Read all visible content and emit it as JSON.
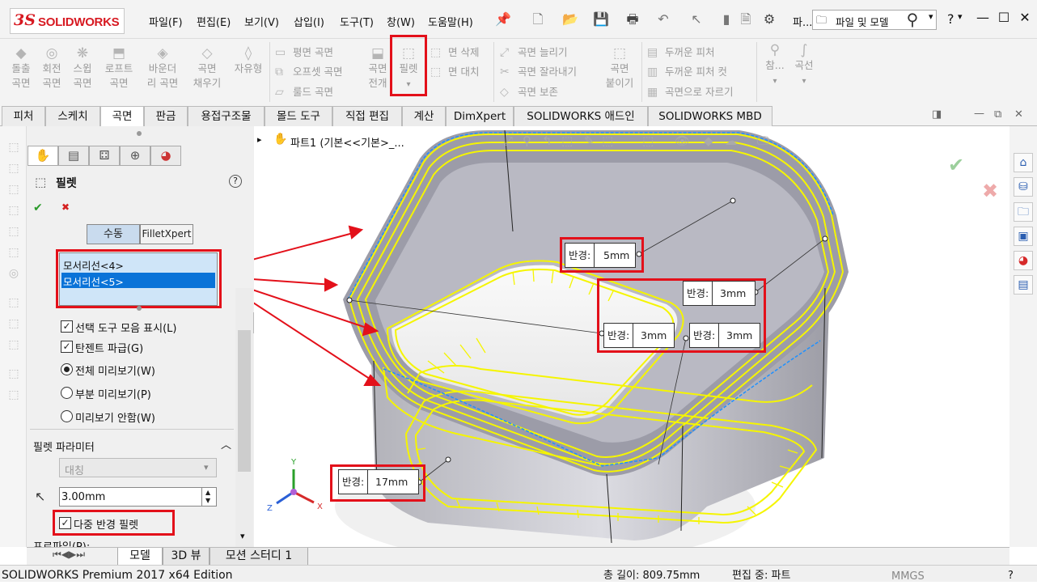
{
  "app": {
    "logo_ds": "3S",
    "logo_text": "SOLIDWORKS"
  },
  "menu": [
    "파일(F)",
    "편집(E)",
    "보기(V)",
    "삽입(I)",
    "도구(T)",
    "창(W)",
    "도움말(H)"
  ],
  "quick": {
    "pin_icon": "pin-icon",
    "label_fa": "파..."
  },
  "search": {
    "label": "파일 및 모델",
    "question": "?"
  },
  "ribbon": {
    "big": [
      {
        "l1": "돌출",
        "l2": "곡면"
      },
      {
        "l1": "회전",
        "l2": "곡면"
      },
      {
        "l1": "스윕",
        "l2": "곡면"
      },
      {
        "l1": "로프트",
        "l2": "곡면"
      },
      {
        "l1": "바운더",
        "l2": "리 곡면"
      },
      {
        "l1": "곡면",
        "l2": "채우기"
      },
      {
        "l1": "자유형",
        "l2": ""
      }
    ],
    "group2": [
      "평면 곡면",
      "오프셋 곡면",
      "룰드 곡면"
    ],
    "group3": {
      "l1": "곡면",
      "l2": "전개"
    },
    "fillet": {
      "label": "필렛",
      "dropdown": "▾"
    },
    "group4": [
      "면 삭제",
      "면 대치"
    ],
    "group5": [
      "곡면 늘리기",
      "곡면 잘라내기",
      "곡면 보존"
    ],
    "group6": {
      "l1": "곡면",
      "l2": "붙이기"
    },
    "group7": [
      "두꺼운 피처",
      "두꺼운 피처 컷",
      "곡면으로 자르기"
    ],
    "group8": {
      "a": "참...",
      "b": "곡선"
    }
  },
  "command_tabs": [
    "피처",
    "스케치",
    "곡면",
    "판금",
    "용접구조물",
    "몰드 도구",
    "직접 편집",
    "계산",
    "DimXpert",
    "SOLIDWORKS 애드인",
    "SOLIDWORKS MBD"
  ],
  "property": {
    "title": "필렛",
    "help": "?",
    "ok": "✔",
    "cancel": "✖",
    "mode_manual": "수동",
    "mode_xpert": "FilletXpert",
    "edges": [
      "모서리선<4>",
      "모서리선<5>"
    ],
    "options": {
      "show_toolbar": "선택 도구 모음 표시(L)",
      "tangent": "탄젠트 파급(G)",
      "full_preview": "전체 미리보기(W)",
      "partial_preview": "부분 미리보기(P)",
      "no_preview": "미리보기 안함(W)"
    },
    "params_header": "필렛 파라미터",
    "symmetric": "대칭",
    "radius_value": "3.00mm",
    "multi_radius": "다중 반경 필렛",
    "profile": "프로파일(P):"
  },
  "viewport": {
    "tree_label": "파트1  (기본<<기본>_...",
    "dims": [
      {
        "key": "반경:",
        "value": "5mm"
      },
      {
        "key": "반경:",
        "value": "3mm"
      },
      {
        "key": "반경:",
        "value": "3mm"
      },
      {
        "key": "반경:",
        "value": "3mm"
      },
      {
        "key": "반경:",
        "value": "17mm"
      }
    ],
    "axes": {
      "x": "X",
      "y": "Y",
      "z": "Z"
    }
  },
  "bottom_tabs": [
    "모델",
    "3D 뷰",
    "모션 스터디 1"
  ],
  "status": {
    "edition": "SOLIDWORKS Premium 2017 x64 Edition",
    "length": "총 길이: 809.75mm",
    "editing": "편집 중: 파트",
    "units": "MMGS",
    "help": "?"
  },
  "colors": {
    "accent_red": "#e3101a",
    "selection_yellow": "#f5f500",
    "selection_blue": "#0a7ad8",
    "brand_red": "#d71921"
  }
}
